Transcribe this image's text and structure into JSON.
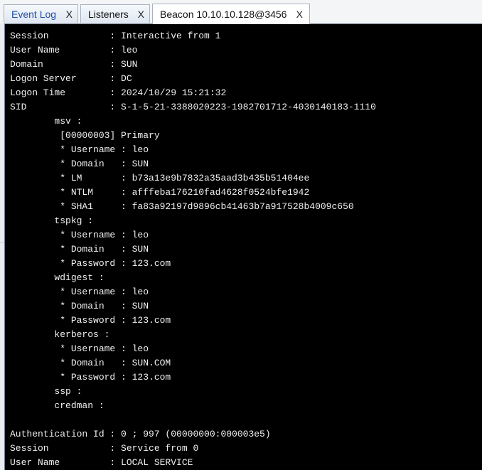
{
  "tabs": [
    {
      "label": "Event Log",
      "close": "X"
    },
    {
      "label": "Listeners",
      "close": "X"
    },
    {
      "label": "Beacon 10.10.10.128@3456",
      "close": "X"
    }
  ],
  "console_lines": [
    "Session           : Interactive from 1",
    "User Name         : leo",
    "Domain            : SUN",
    "Logon Server      : DC",
    "Logon Time        : 2024/10/29 15:21:32",
    "SID               : S-1-5-21-3388020223-1982701712-4030140183-1110",
    "        msv :",
    "         [00000003] Primary",
    "         * Username : leo",
    "         * Domain   : SUN",
    "         * LM       : b73a13e9b7832a35aad3b435b51404ee",
    "         * NTLM     : afffeba176210fad4628f0524bfe1942",
    "         * SHA1     : fa83a92197d9896cb41463b7a917528b4009c650",
    "        tspkg :",
    "         * Username : leo",
    "         * Domain   : SUN",
    "         * Password : 123.com",
    "        wdigest :",
    "         * Username : leo",
    "         * Domain   : SUN",
    "         * Password : 123.com",
    "        kerberos :",
    "         * Username : leo",
    "         * Domain   : SUN.COM",
    "         * Password : 123.com",
    "        ssp :",
    "        credman :",
    "",
    "Authentication Id : 0 ; 997 (00000000:000003e5)",
    "Session           : Service from 0",
    "User Name         : LOCAL SERVICE"
  ]
}
